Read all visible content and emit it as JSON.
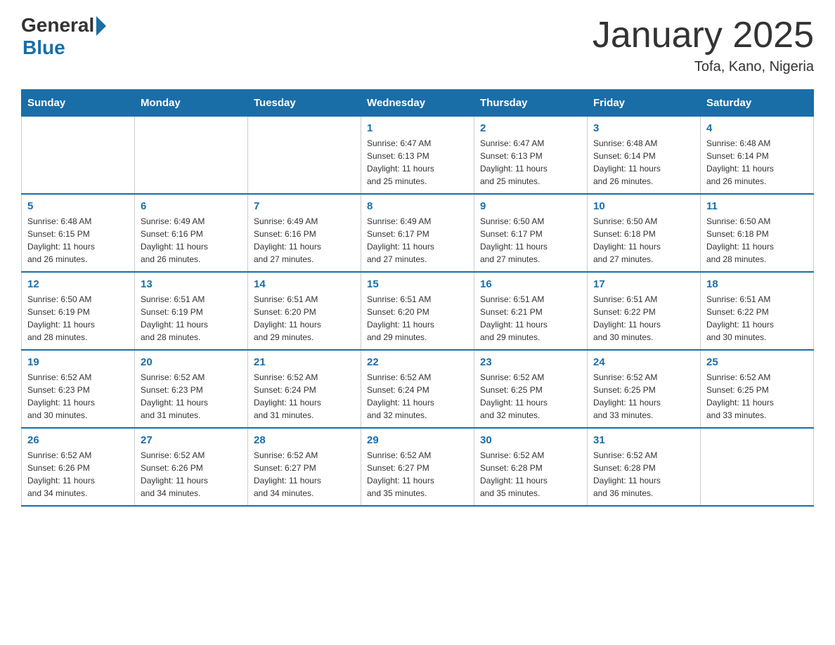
{
  "logo": {
    "general": "General",
    "blue": "Blue"
  },
  "title": "January 2025",
  "location": "Tofa, Kano, Nigeria",
  "weekdays": [
    "Sunday",
    "Monday",
    "Tuesday",
    "Wednesday",
    "Thursday",
    "Friday",
    "Saturday"
  ],
  "weeks": [
    [
      {
        "day": "",
        "info": ""
      },
      {
        "day": "",
        "info": ""
      },
      {
        "day": "",
        "info": ""
      },
      {
        "day": "1",
        "info": "Sunrise: 6:47 AM\nSunset: 6:13 PM\nDaylight: 11 hours\nand 25 minutes."
      },
      {
        "day": "2",
        "info": "Sunrise: 6:47 AM\nSunset: 6:13 PM\nDaylight: 11 hours\nand 25 minutes."
      },
      {
        "day": "3",
        "info": "Sunrise: 6:48 AM\nSunset: 6:14 PM\nDaylight: 11 hours\nand 26 minutes."
      },
      {
        "day": "4",
        "info": "Sunrise: 6:48 AM\nSunset: 6:14 PM\nDaylight: 11 hours\nand 26 minutes."
      }
    ],
    [
      {
        "day": "5",
        "info": "Sunrise: 6:48 AM\nSunset: 6:15 PM\nDaylight: 11 hours\nand 26 minutes."
      },
      {
        "day": "6",
        "info": "Sunrise: 6:49 AM\nSunset: 6:16 PM\nDaylight: 11 hours\nand 26 minutes."
      },
      {
        "day": "7",
        "info": "Sunrise: 6:49 AM\nSunset: 6:16 PM\nDaylight: 11 hours\nand 27 minutes."
      },
      {
        "day": "8",
        "info": "Sunrise: 6:49 AM\nSunset: 6:17 PM\nDaylight: 11 hours\nand 27 minutes."
      },
      {
        "day": "9",
        "info": "Sunrise: 6:50 AM\nSunset: 6:17 PM\nDaylight: 11 hours\nand 27 minutes."
      },
      {
        "day": "10",
        "info": "Sunrise: 6:50 AM\nSunset: 6:18 PM\nDaylight: 11 hours\nand 27 minutes."
      },
      {
        "day": "11",
        "info": "Sunrise: 6:50 AM\nSunset: 6:18 PM\nDaylight: 11 hours\nand 28 minutes."
      }
    ],
    [
      {
        "day": "12",
        "info": "Sunrise: 6:50 AM\nSunset: 6:19 PM\nDaylight: 11 hours\nand 28 minutes."
      },
      {
        "day": "13",
        "info": "Sunrise: 6:51 AM\nSunset: 6:19 PM\nDaylight: 11 hours\nand 28 minutes."
      },
      {
        "day": "14",
        "info": "Sunrise: 6:51 AM\nSunset: 6:20 PM\nDaylight: 11 hours\nand 29 minutes."
      },
      {
        "day": "15",
        "info": "Sunrise: 6:51 AM\nSunset: 6:20 PM\nDaylight: 11 hours\nand 29 minutes."
      },
      {
        "day": "16",
        "info": "Sunrise: 6:51 AM\nSunset: 6:21 PM\nDaylight: 11 hours\nand 29 minutes."
      },
      {
        "day": "17",
        "info": "Sunrise: 6:51 AM\nSunset: 6:22 PM\nDaylight: 11 hours\nand 30 minutes."
      },
      {
        "day": "18",
        "info": "Sunrise: 6:51 AM\nSunset: 6:22 PM\nDaylight: 11 hours\nand 30 minutes."
      }
    ],
    [
      {
        "day": "19",
        "info": "Sunrise: 6:52 AM\nSunset: 6:23 PM\nDaylight: 11 hours\nand 30 minutes."
      },
      {
        "day": "20",
        "info": "Sunrise: 6:52 AM\nSunset: 6:23 PM\nDaylight: 11 hours\nand 31 minutes."
      },
      {
        "day": "21",
        "info": "Sunrise: 6:52 AM\nSunset: 6:24 PM\nDaylight: 11 hours\nand 31 minutes."
      },
      {
        "day": "22",
        "info": "Sunrise: 6:52 AM\nSunset: 6:24 PM\nDaylight: 11 hours\nand 32 minutes."
      },
      {
        "day": "23",
        "info": "Sunrise: 6:52 AM\nSunset: 6:25 PM\nDaylight: 11 hours\nand 32 minutes."
      },
      {
        "day": "24",
        "info": "Sunrise: 6:52 AM\nSunset: 6:25 PM\nDaylight: 11 hours\nand 33 minutes."
      },
      {
        "day": "25",
        "info": "Sunrise: 6:52 AM\nSunset: 6:25 PM\nDaylight: 11 hours\nand 33 minutes."
      }
    ],
    [
      {
        "day": "26",
        "info": "Sunrise: 6:52 AM\nSunset: 6:26 PM\nDaylight: 11 hours\nand 34 minutes."
      },
      {
        "day": "27",
        "info": "Sunrise: 6:52 AM\nSunset: 6:26 PM\nDaylight: 11 hours\nand 34 minutes."
      },
      {
        "day": "28",
        "info": "Sunrise: 6:52 AM\nSunset: 6:27 PM\nDaylight: 11 hours\nand 34 minutes."
      },
      {
        "day": "29",
        "info": "Sunrise: 6:52 AM\nSunset: 6:27 PM\nDaylight: 11 hours\nand 35 minutes."
      },
      {
        "day": "30",
        "info": "Sunrise: 6:52 AM\nSunset: 6:28 PM\nDaylight: 11 hours\nand 35 minutes."
      },
      {
        "day": "31",
        "info": "Sunrise: 6:52 AM\nSunset: 6:28 PM\nDaylight: 11 hours\nand 36 minutes."
      },
      {
        "day": "",
        "info": ""
      }
    ]
  ]
}
